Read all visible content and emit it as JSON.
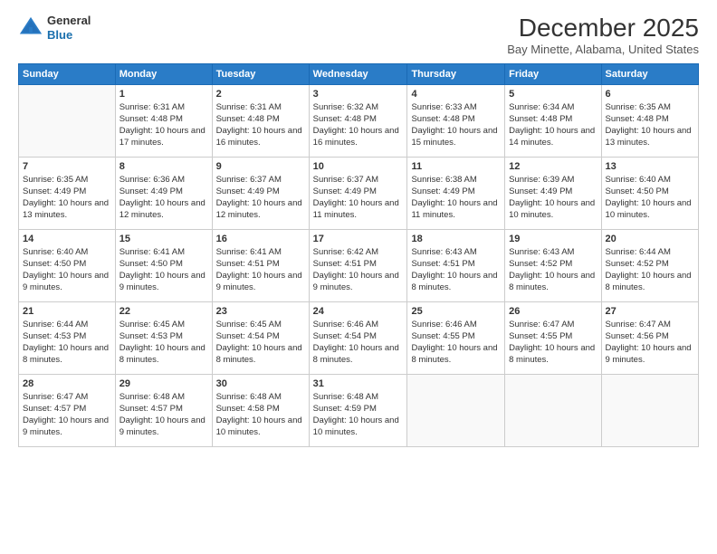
{
  "logo": {
    "line1": "General",
    "line2": "Blue"
  },
  "title": "December 2025",
  "subtitle": "Bay Minette, Alabama, United States",
  "days_of_week": [
    "Sunday",
    "Monday",
    "Tuesday",
    "Wednesday",
    "Thursday",
    "Friday",
    "Saturday"
  ],
  "weeks": [
    [
      {
        "day": "",
        "info": ""
      },
      {
        "day": "1",
        "info": "Sunrise: 6:31 AM\nSunset: 4:48 PM\nDaylight: 10 hours\nand 17 minutes."
      },
      {
        "day": "2",
        "info": "Sunrise: 6:31 AM\nSunset: 4:48 PM\nDaylight: 10 hours\nand 16 minutes."
      },
      {
        "day": "3",
        "info": "Sunrise: 6:32 AM\nSunset: 4:48 PM\nDaylight: 10 hours\nand 16 minutes."
      },
      {
        "day": "4",
        "info": "Sunrise: 6:33 AM\nSunset: 4:48 PM\nDaylight: 10 hours\nand 15 minutes."
      },
      {
        "day": "5",
        "info": "Sunrise: 6:34 AM\nSunset: 4:48 PM\nDaylight: 10 hours\nand 14 minutes."
      },
      {
        "day": "6",
        "info": "Sunrise: 6:35 AM\nSunset: 4:48 PM\nDaylight: 10 hours\nand 13 minutes."
      }
    ],
    [
      {
        "day": "7",
        "info": "Sunrise: 6:35 AM\nSunset: 4:49 PM\nDaylight: 10 hours\nand 13 minutes."
      },
      {
        "day": "8",
        "info": "Sunrise: 6:36 AM\nSunset: 4:49 PM\nDaylight: 10 hours\nand 12 minutes."
      },
      {
        "day": "9",
        "info": "Sunrise: 6:37 AM\nSunset: 4:49 PM\nDaylight: 10 hours\nand 12 minutes."
      },
      {
        "day": "10",
        "info": "Sunrise: 6:37 AM\nSunset: 4:49 PM\nDaylight: 10 hours\nand 11 minutes."
      },
      {
        "day": "11",
        "info": "Sunrise: 6:38 AM\nSunset: 4:49 PM\nDaylight: 10 hours\nand 11 minutes."
      },
      {
        "day": "12",
        "info": "Sunrise: 6:39 AM\nSunset: 4:49 PM\nDaylight: 10 hours\nand 10 minutes."
      },
      {
        "day": "13",
        "info": "Sunrise: 6:40 AM\nSunset: 4:50 PM\nDaylight: 10 hours\nand 10 minutes."
      }
    ],
    [
      {
        "day": "14",
        "info": "Sunrise: 6:40 AM\nSunset: 4:50 PM\nDaylight: 10 hours\nand 9 minutes."
      },
      {
        "day": "15",
        "info": "Sunrise: 6:41 AM\nSunset: 4:50 PM\nDaylight: 10 hours\nand 9 minutes."
      },
      {
        "day": "16",
        "info": "Sunrise: 6:41 AM\nSunset: 4:51 PM\nDaylight: 10 hours\nand 9 minutes."
      },
      {
        "day": "17",
        "info": "Sunrise: 6:42 AM\nSunset: 4:51 PM\nDaylight: 10 hours\nand 9 minutes."
      },
      {
        "day": "18",
        "info": "Sunrise: 6:43 AM\nSunset: 4:51 PM\nDaylight: 10 hours\nand 8 minutes."
      },
      {
        "day": "19",
        "info": "Sunrise: 6:43 AM\nSunset: 4:52 PM\nDaylight: 10 hours\nand 8 minutes."
      },
      {
        "day": "20",
        "info": "Sunrise: 6:44 AM\nSunset: 4:52 PM\nDaylight: 10 hours\nand 8 minutes."
      }
    ],
    [
      {
        "day": "21",
        "info": "Sunrise: 6:44 AM\nSunset: 4:53 PM\nDaylight: 10 hours\nand 8 minutes."
      },
      {
        "day": "22",
        "info": "Sunrise: 6:45 AM\nSunset: 4:53 PM\nDaylight: 10 hours\nand 8 minutes."
      },
      {
        "day": "23",
        "info": "Sunrise: 6:45 AM\nSunset: 4:54 PM\nDaylight: 10 hours\nand 8 minutes."
      },
      {
        "day": "24",
        "info": "Sunrise: 6:46 AM\nSunset: 4:54 PM\nDaylight: 10 hours\nand 8 minutes."
      },
      {
        "day": "25",
        "info": "Sunrise: 6:46 AM\nSunset: 4:55 PM\nDaylight: 10 hours\nand 8 minutes."
      },
      {
        "day": "26",
        "info": "Sunrise: 6:47 AM\nSunset: 4:55 PM\nDaylight: 10 hours\nand 8 minutes."
      },
      {
        "day": "27",
        "info": "Sunrise: 6:47 AM\nSunset: 4:56 PM\nDaylight: 10 hours\nand 9 minutes."
      }
    ],
    [
      {
        "day": "28",
        "info": "Sunrise: 6:47 AM\nSunset: 4:57 PM\nDaylight: 10 hours\nand 9 minutes."
      },
      {
        "day": "29",
        "info": "Sunrise: 6:48 AM\nSunset: 4:57 PM\nDaylight: 10 hours\nand 9 minutes."
      },
      {
        "day": "30",
        "info": "Sunrise: 6:48 AM\nSunset: 4:58 PM\nDaylight: 10 hours\nand 10 minutes."
      },
      {
        "day": "31",
        "info": "Sunrise: 6:48 AM\nSunset: 4:59 PM\nDaylight: 10 hours\nand 10 minutes."
      },
      {
        "day": "",
        "info": ""
      },
      {
        "day": "",
        "info": ""
      },
      {
        "day": "",
        "info": ""
      }
    ]
  ]
}
